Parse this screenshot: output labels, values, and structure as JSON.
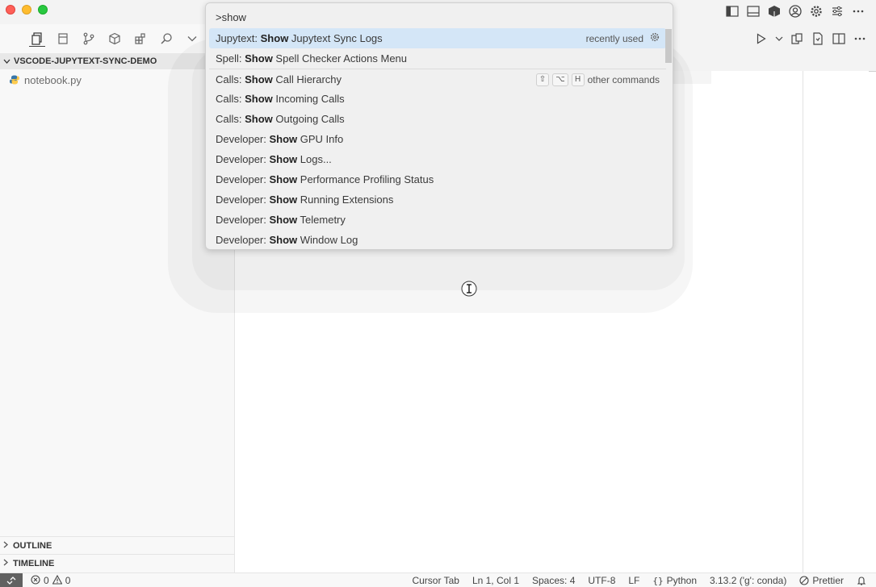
{
  "explorer": {
    "root_label": "VSCODE-JUPYTEXT-SYNC-DEMO",
    "files": [
      {
        "name": "notebook.py"
      }
    ],
    "outline_label": "OUTLINE",
    "timeline_label": "TIMELINE"
  },
  "palette": {
    "query": ">show",
    "items": [
      {
        "prefix": "Jupytext: ",
        "match": "Show",
        "rest": " Jupytext Sync Logs",
        "right_text": "recently used"
      },
      {
        "prefix": "Spell: ",
        "match": "Show",
        "rest": " Spell Checker Actions Menu"
      },
      {
        "prefix": "Calls: ",
        "match": "Show",
        "rest": " Call Hierarchy",
        "keys": [
          "⇧",
          "⌥",
          "H"
        ],
        "right_text": "other commands"
      },
      {
        "prefix": "Calls: ",
        "match": "Show",
        "rest": " Incoming Calls"
      },
      {
        "prefix": "Calls: ",
        "match": "Show",
        "rest": " Outgoing Calls"
      },
      {
        "prefix": "Developer: ",
        "match": "Show",
        "rest": " GPU Info"
      },
      {
        "prefix": "Developer: ",
        "match": "Show",
        "rest": " Logs..."
      },
      {
        "prefix": "Developer: ",
        "match": "Show",
        "rest": " Performance Profiling Status"
      },
      {
        "prefix": "Developer: ",
        "match": "Show",
        "rest": " Running Extensions"
      },
      {
        "prefix": "Developer: ",
        "match": "Show",
        "rest": " Telemetry"
      },
      {
        "prefix": "Developer: ",
        "match": "Show",
        "rest": " Window Log"
      }
    ]
  },
  "statusbar": {
    "errors": "0",
    "warnings": "0",
    "cursor_tab": "Cursor Tab",
    "position": "Ln 1, Col 1",
    "spaces": "Spaces: 4",
    "encoding": "UTF-8",
    "eol": "LF",
    "language": "Python",
    "interpreter": "3.13.2 ('g': conda)",
    "formatter": "Prettier"
  },
  "colors": {
    "selection": "#d4e6f7",
    "remote": "#616161",
    "python": "#3776ab"
  }
}
